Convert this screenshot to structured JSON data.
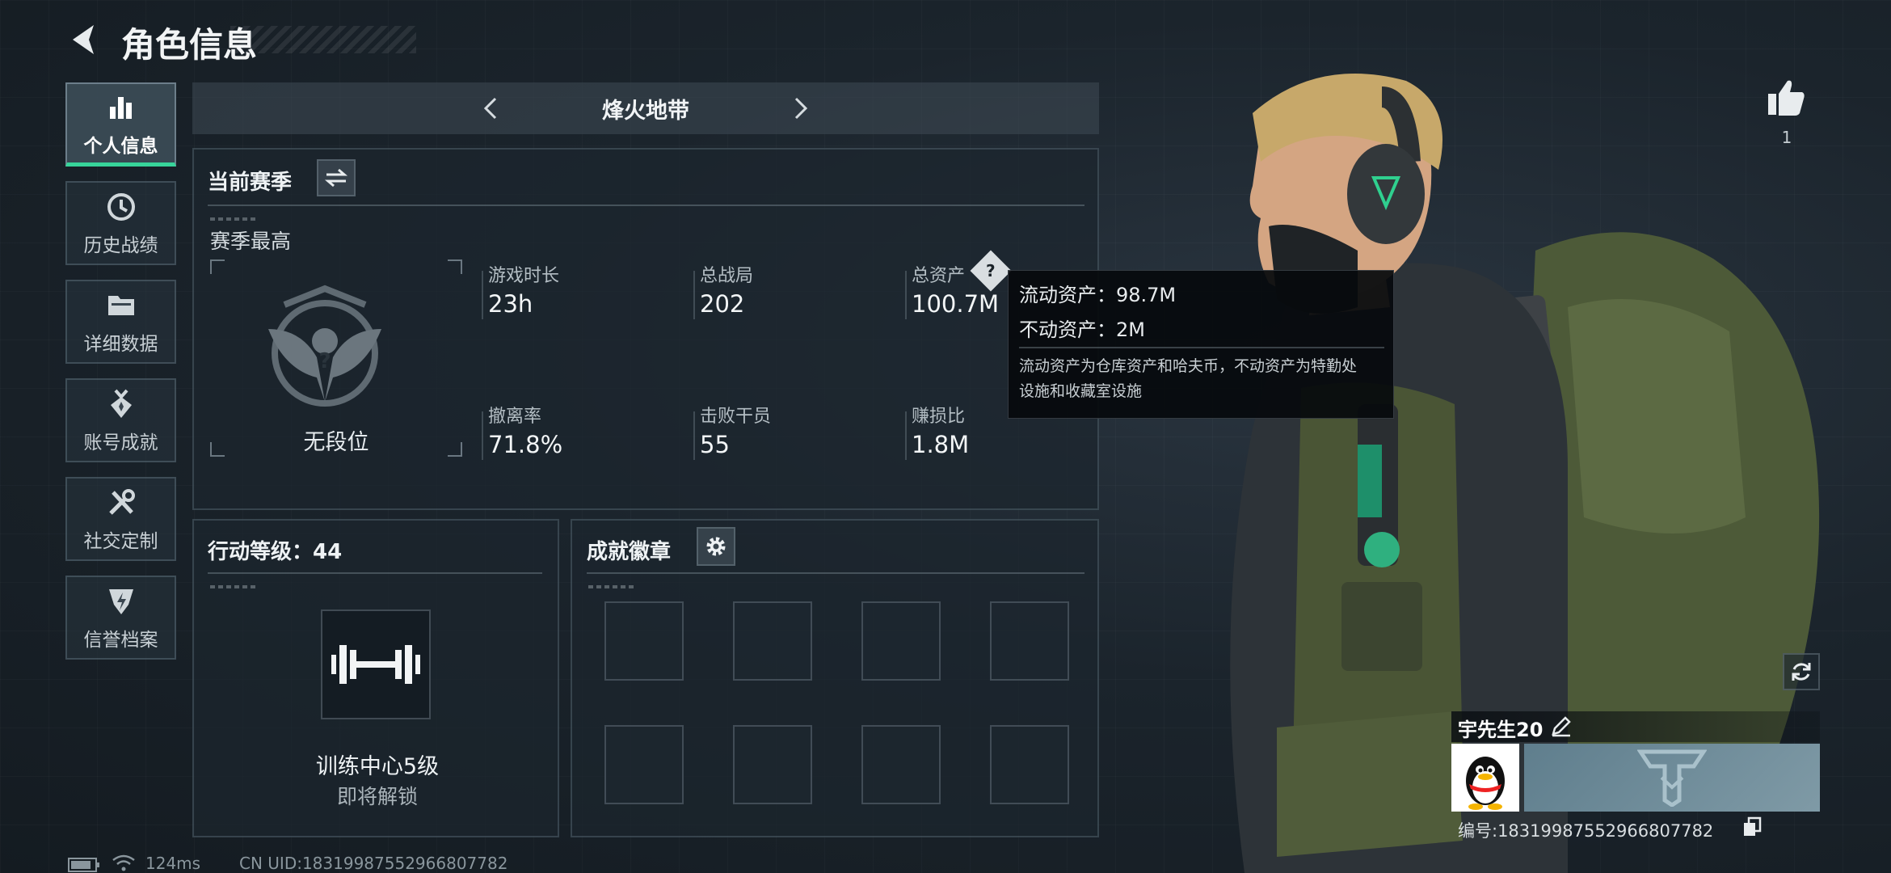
{
  "header": {
    "title": "角色信息"
  },
  "sidebar": {
    "items": [
      {
        "label": "个人信息",
        "icon": "bar-chart-icon",
        "active": true
      },
      {
        "label": "历史战绩",
        "icon": "clock-icon",
        "active": false
      },
      {
        "label": "详细数据",
        "icon": "folder-icon",
        "active": false
      },
      {
        "label": "账号成就",
        "icon": "medal-icon",
        "active": false
      },
      {
        "label": "社交定制",
        "icon": "tools-icon",
        "active": false
      },
      {
        "label": "信誉档案",
        "icon": "shield-icon",
        "active": false
      }
    ]
  },
  "mode_selector": {
    "current": "烽火地带"
  },
  "season": {
    "title": "当前赛季",
    "best_label": "赛季最高",
    "rank": "无段位",
    "stats": [
      {
        "label": "游戏时长",
        "value": "23h"
      },
      {
        "label": "总战局",
        "value": "202"
      },
      {
        "label": "总资产",
        "value": "100.7M"
      },
      {
        "label": "撤离率",
        "value": "71.8%"
      },
      {
        "label": "击败干员",
        "value": "55"
      },
      {
        "label": "赚损比",
        "value": "1.8M"
      }
    ]
  },
  "tooltip": {
    "liquid": "流动资产：98.7M",
    "fixed": "不动资产：2M",
    "desc_line1": "流动资产为仓库资产和哈夫币，不动资产为特勤处",
    "desc_line2": "设施和收藏室设施"
  },
  "action_level": {
    "title": "行动等级：44",
    "unlock_name": "训练中心5级",
    "unlock_status": "即将解锁"
  },
  "badges": {
    "title": "成就徽章",
    "slots": 8
  },
  "like": {
    "count": "1"
  },
  "player": {
    "name": "宇先生20",
    "id_text": "编号:18319987552966807782"
  },
  "footer": {
    "ping": "124ms",
    "uid": "CN UID:18319987552966807782"
  },
  "colors": {
    "accent": "#37d49a",
    "background": "#1b242c"
  }
}
